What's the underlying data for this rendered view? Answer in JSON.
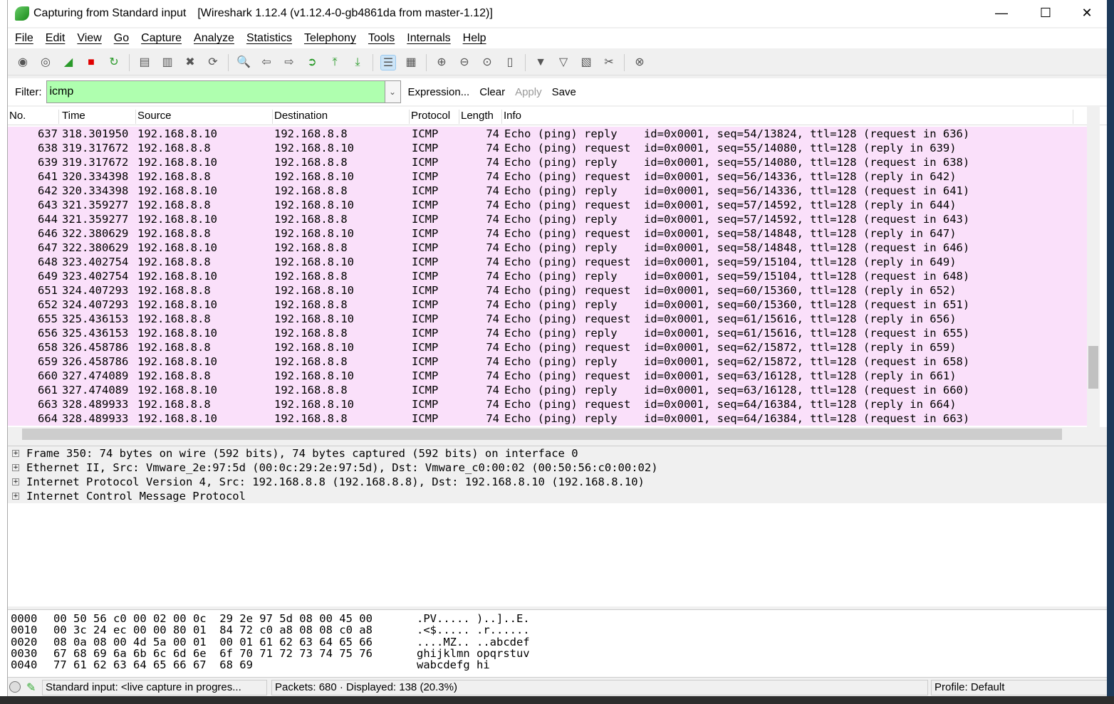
{
  "window": {
    "title": "Capturing from Standard input",
    "subtitle": "[Wireshark 1.12.4  (v1.12.4-0-gb4861da from master-1.12)]",
    "minimize": "—",
    "maximize": "☐",
    "close": "✕"
  },
  "menu": [
    "File",
    "Edit",
    "View",
    "Go",
    "Capture",
    "Analyze",
    "Statistics",
    "Telephony",
    "Tools",
    "Internals",
    "Help"
  ],
  "toolbar": [
    [
      "interfaces-icon",
      "◉"
    ],
    [
      "options-icon",
      "◎"
    ],
    [
      "start-capture-icon",
      "◢"
    ],
    [
      "stop-capture-icon",
      "■"
    ],
    [
      "restart-capture-icon",
      "↻"
    ],
    [
      "|",
      ""
    ],
    [
      "open-icon",
      "▤"
    ],
    [
      "save-icon",
      "▥"
    ],
    [
      "close-file-icon",
      "✖"
    ],
    [
      "reload-icon",
      "⟳"
    ],
    [
      "|",
      ""
    ],
    [
      "find-icon",
      "🔍"
    ],
    [
      "back-icon",
      "⇦"
    ],
    [
      "forward-icon",
      "⇨"
    ],
    [
      "goto-icon",
      "➲"
    ],
    [
      "first-packet-icon",
      "⤒"
    ],
    [
      "last-packet-icon",
      "⤓"
    ],
    [
      "|",
      ""
    ],
    [
      "colorize-icon",
      "☰"
    ],
    [
      "autoscroll-icon",
      "▦"
    ],
    [
      "|",
      ""
    ],
    [
      "zoom-in-icon",
      "⊕"
    ],
    [
      "zoom-out-icon",
      "⊖"
    ],
    [
      "zoom-normal-icon",
      "⊙"
    ],
    [
      "resize-columns-icon",
      "▯"
    ],
    [
      "|",
      ""
    ],
    [
      "capture-filters-icon",
      "▼"
    ],
    [
      "display-filters-icon",
      "▽"
    ],
    [
      "coloring-rules-icon",
      "▧"
    ],
    [
      "preferences-icon",
      "✂"
    ],
    [
      "|",
      ""
    ],
    [
      "help-icon",
      "⊗"
    ]
  ],
  "toolbar_colors": {
    "stop": "#e00000",
    "start": "#2a9a2a",
    "filter_bg": "#afffaf",
    "row_bg": "#fae0fa"
  },
  "filter": {
    "label": "Filter:",
    "value": "icmp",
    "expression": "Expression...",
    "clear": "Clear",
    "apply": "Apply",
    "save": "Save"
  },
  "columns": [
    "No.",
    "Time",
    "Source",
    "Destination",
    "Protocol",
    "Length",
    "Info"
  ],
  "packets": [
    [
      "637",
      "318.301950",
      "192.168.8.10",
      "192.168.8.8",
      "ICMP",
      "74",
      "Echo (ping) reply    id=0x0001, seq=54/13824, ttl=128 (request in 636)"
    ],
    [
      "638",
      "319.317672",
      "192.168.8.8",
      "192.168.8.10",
      "ICMP",
      "74",
      "Echo (ping) request  id=0x0001, seq=55/14080, ttl=128 (reply in 639)"
    ],
    [
      "639",
      "319.317672",
      "192.168.8.10",
      "192.168.8.8",
      "ICMP",
      "74",
      "Echo (ping) reply    id=0x0001, seq=55/14080, ttl=128 (request in 638)"
    ],
    [
      "641",
      "320.334398",
      "192.168.8.8",
      "192.168.8.10",
      "ICMP",
      "74",
      "Echo (ping) request  id=0x0001, seq=56/14336, ttl=128 (reply in 642)"
    ],
    [
      "642",
      "320.334398",
      "192.168.8.10",
      "192.168.8.8",
      "ICMP",
      "74",
      "Echo (ping) reply    id=0x0001, seq=56/14336, ttl=128 (request in 641)"
    ],
    [
      "643",
      "321.359277",
      "192.168.8.8",
      "192.168.8.10",
      "ICMP",
      "74",
      "Echo (ping) request  id=0x0001, seq=57/14592, ttl=128 (reply in 644)"
    ],
    [
      "644",
      "321.359277",
      "192.168.8.10",
      "192.168.8.8",
      "ICMP",
      "74",
      "Echo (ping) reply    id=0x0001, seq=57/14592, ttl=128 (request in 643)"
    ],
    [
      "646",
      "322.380629",
      "192.168.8.8",
      "192.168.8.10",
      "ICMP",
      "74",
      "Echo (ping) request  id=0x0001, seq=58/14848, ttl=128 (reply in 647)"
    ],
    [
      "647",
      "322.380629",
      "192.168.8.10",
      "192.168.8.8",
      "ICMP",
      "74",
      "Echo (ping) reply    id=0x0001, seq=58/14848, ttl=128 (request in 646)"
    ],
    [
      "648",
      "323.402754",
      "192.168.8.8",
      "192.168.8.10",
      "ICMP",
      "74",
      "Echo (ping) request  id=0x0001, seq=59/15104, ttl=128 (reply in 649)"
    ],
    [
      "649",
      "323.402754",
      "192.168.8.10",
      "192.168.8.8",
      "ICMP",
      "74",
      "Echo (ping) reply    id=0x0001, seq=59/15104, ttl=128 (request in 648)"
    ],
    [
      "651",
      "324.407293",
      "192.168.8.8",
      "192.168.8.10",
      "ICMP",
      "74",
      "Echo (ping) request  id=0x0001, seq=60/15360, ttl=128 (reply in 652)"
    ],
    [
      "652",
      "324.407293",
      "192.168.8.10",
      "192.168.8.8",
      "ICMP",
      "74",
      "Echo (ping) reply    id=0x0001, seq=60/15360, ttl=128 (request in 651)"
    ],
    [
      "655",
      "325.436153",
      "192.168.8.8",
      "192.168.8.10",
      "ICMP",
      "74",
      "Echo (ping) request  id=0x0001, seq=61/15616, ttl=128 (reply in 656)"
    ],
    [
      "656",
      "325.436153",
      "192.168.8.10",
      "192.168.8.8",
      "ICMP",
      "74",
      "Echo (ping) reply    id=0x0001, seq=61/15616, ttl=128 (request in 655)"
    ],
    [
      "658",
      "326.458786",
      "192.168.8.8",
      "192.168.8.10",
      "ICMP",
      "74",
      "Echo (ping) request  id=0x0001, seq=62/15872, ttl=128 (reply in 659)"
    ],
    [
      "659",
      "326.458786",
      "192.168.8.10",
      "192.168.8.8",
      "ICMP",
      "74",
      "Echo (ping) reply    id=0x0001, seq=62/15872, ttl=128 (request in 658)"
    ],
    [
      "660",
      "327.474089",
      "192.168.8.8",
      "192.168.8.10",
      "ICMP",
      "74",
      "Echo (ping) request  id=0x0001, seq=63/16128, ttl=128 (reply in 661)"
    ],
    [
      "661",
      "327.474089",
      "192.168.8.10",
      "192.168.8.8",
      "ICMP",
      "74",
      "Echo (ping) reply    id=0x0001, seq=63/16128, ttl=128 (request in 660)"
    ],
    [
      "663",
      "328.489933",
      "192.168.8.8",
      "192.168.8.10",
      "ICMP",
      "74",
      "Echo (ping) request  id=0x0001, seq=64/16384, ttl=128 (reply in 664)"
    ],
    [
      "664",
      "328.489933",
      "192.168.8.10",
      "192.168.8.8",
      "ICMP",
      "74",
      "Echo (ping) reply    id=0x0001, seq=64/16384, ttl=128 (request in 663)"
    ]
  ],
  "details": [
    "Frame 350: 74 bytes on wire (592 bits), 74 bytes captured (592 bits) on interface 0",
    "Ethernet II, Src: Vmware_2e:97:5d (00:0c:29:2e:97:5d), Dst: Vmware_c0:00:02 (00:50:56:c0:00:02)",
    "Internet Protocol Version 4, Src: 192.168.8.8 (192.168.8.8), Dst: 192.168.8.10 (192.168.8.10)",
    "Internet Control Message Protocol"
  ],
  "hex": [
    [
      "0000",
      "00 50 56 c0 00 02 00 0c  29 2e 97 5d 08 00 45 00",
      ".PV..... )..]..E."
    ],
    [
      "0010",
      "00 3c 24 ec 00 00 80 01  84 72 c0 a8 08 08 c0 a8",
      ".<$..... .r......"
    ],
    [
      "0020",
      "08 0a 08 00 4d 5a 00 01  00 01 61 62 63 64 65 66",
      "....MZ.. ..abcdef"
    ],
    [
      "0030",
      "67 68 69 6a 6b 6c 6d 6e  6f 70 71 72 73 74 75 76",
      "ghijklmn opqrstuv"
    ],
    [
      "0040",
      "77 61 62 63 64 65 66 67  68 69",
      "wabcdefg hi"
    ]
  ],
  "status": {
    "source": "Standard input: <live capture in progres...",
    "packets": "Packets: 680 · Displayed: 138 (20.3%)",
    "profile": "Profile: Default"
  }
}
